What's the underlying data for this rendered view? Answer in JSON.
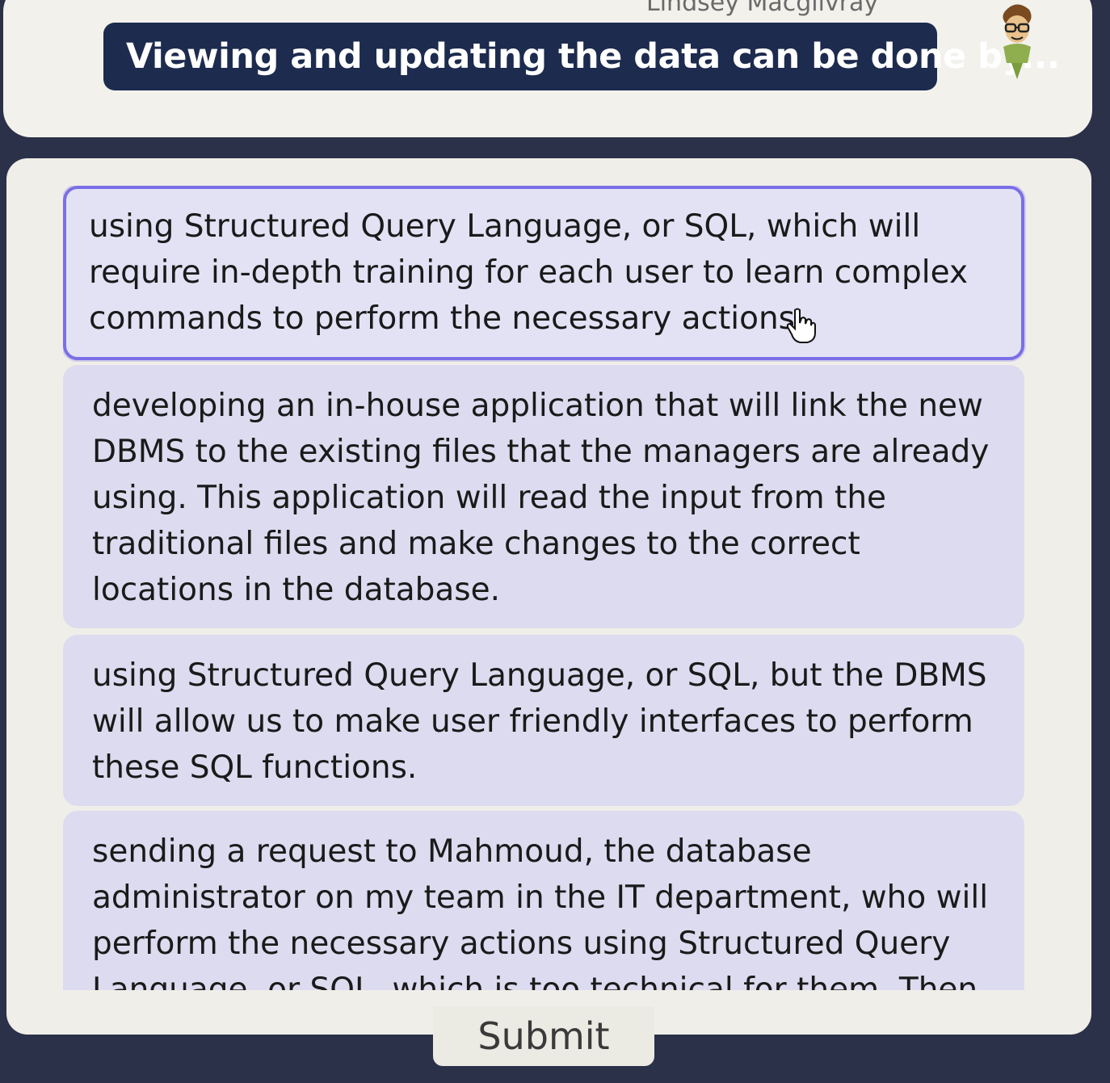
{
  "header": {
    "speaker_name": "Lindsey Macgilvray",
    "question": "Viewing and updating the data can be done by..."
  },
  "answers": [
    {
      "text": "using Structured Query Language, or SQL, which will require in-depth training for each user to learn complex commands to perform the necessary actions.",
      "selected": true
    },
    {
      "text": "developing an in-house application that will link the new DBMS to the existing files that the managers are already using. This application will read the input from the traditional files and make changes to the correct locations in the database.",
      "selected": false
    },
    {
      "text": "using Structured Query Language, or SQL, but the DBMS will allow us to make user friendly interfaces to perform these SQL functions.",
      "selected": false
    },
    {
      "text": "sending a request to Mahmoud, the database administrator on my team in the IT department, who will perform the necessary actions using Structured Query Language, or SQL, which is too technical for them. Then",
      "selected": false
    }
  ],
  "submit_label": "Submit",
  "colors": {
    "banner": "#1c2b4e",
    "selected_border": "#7b6fe6",
    "option_bg": "#dcdbef",
    "background": "#2b3148"
  }
}
